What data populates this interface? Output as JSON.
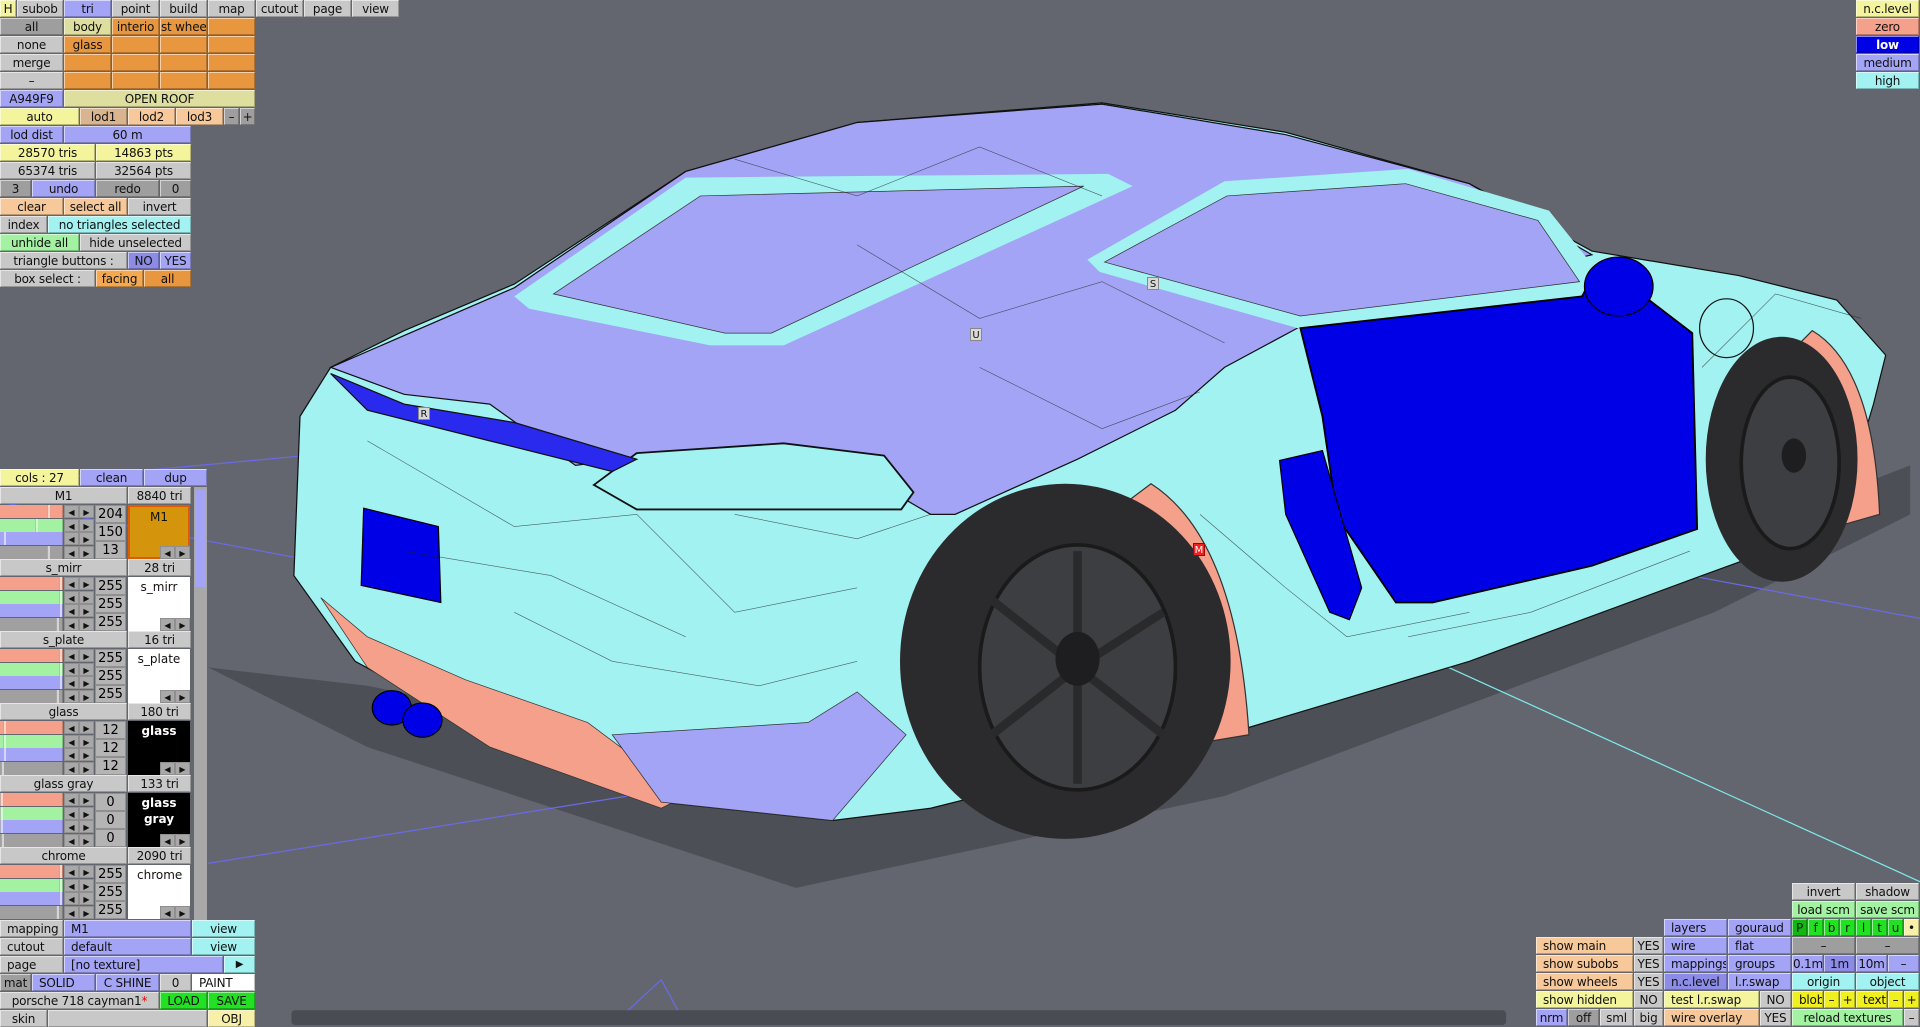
{
  "colors": {
    "body_high": "#a2f2f2",
    "roof_medium": "#a4a4f6",
    "door_low": "#0000e6",
    "zero": "#f5a08a",
    "tire": "#2b2b2d",
    "ground": "#63666f"
  },
  "top_tabs": [
    "H",
    "subob",
    "tri",
    "point",
    "build",
    "map",
    "cutout",
    "page",
    "view"
  ],
  "select": {
    "all": "all",
    "none": "none",
    "merge": "merge",
    "dash": "–"
  },
  "groups": [
    "body",
    "interio",
    "st whee",
    "glass"
  ],
  "color_code": "A949F9",
  "open_roof": "OPEN ROOF",
  "lod": {
    "auto": "auto",
    "lod1": "lod1",
    "lod2": "lod2",
    "lod3": "lod3",
    "minus": "–",
    "plus": "+",
    "dist_label": "lod dist",
    "dist_value": "60 m"
  },
  "stats": {
    "sel_tris": "28570 tris",
    "sel_pts": "14863 pts",
    "total_tris": "65374 tris",
    "total_pts": "32564 pts"
  },
  "history": {
    "undo_count": "3",
    "undo": "undo",
    "redo": "redo",
    "redo_count": "0"
  },
  "selection": {
    "clear": "clear",
    "select_all": "select all",
    "invert": "invert",
    "index": "index",
    "status": "no triangles selected",
    "unhide_all": "unhide all",
    "hide_unselected": "hide unselected",
    "triangle_buttons": "triangle buttons :",
    "no": "NO",
    "yes": "YES",
    "box_select": "box select :",
    "facing": "facing",
    "all": "all"
  },
  "nc_level": {
    "title": "n.c.level",
    "zero": "zero",
    "low": "low",
    "medium": "medium",
    "high": "high"
  },
  "viewport_labels": {
    "u": "U",
    "s": "S",
    "r": "R",
    "m": "M"
  },
  "materials_header": {
    "cols": "cols : 27",
    "clean": "clean",
    "dup": "dup"
  },
  "materials": [
    {
      "name": "M1",
      "tris": "8840 tri",
      "values": [
        204,
        150,
        13
      ],
      "shine": 0.8,
      "preview": "M1",
      "preview_bg": "#d4940c",
      "preview_fg": "#111",
      "selected": true
    },
    {
      "name": "s_mirr",
      "tris": "28 tri",
      "values": [
        255,
        255,
        255
      ],
      "shine": 0.95,
      "preview": "s_mirr",
      "preview_bg": "#ffffff",
      "preview_fg": "#111"
    },
    {
      "name": "s_plate",
      "tris": "16 tri",
      "values": [
        255,
        255,
        255
      ],
      "shine": 0.95,
      "preview": "s_plate",
      "preview_bg": "#ffffff",
      "preview_fg": "#111"
    },
    {
      "name": "glass",
      "tris": "180 tri",
      "values": [
        12,
        12,
        12
      ],
      "shine": 0.02,
      "preview": "glass",
      "preview_bg": "#000000",
      "preview_fg": "#ffffff"
    },
    {
      "name": "glass gray",
      "tris": "133 tri",
      "values": [
        0,
        0,
        0
      ],
      "shine": 0.02,
      "preview": "glass gray",
      "preview_bg": "#000000",
      "preview_fg": "#ffffff"
    },
    {
      "name": "chrome",
      "tris": "2090 tri",
      "values": [
        255,
        255,
        255
      ],
      "shine": 0.95,
      "preview": "chrome",
      "preview_bg": "#ffffff",
      "preview_fg": "#111"
    }
  ],
  "bottom_left": {
    "mapping": "mapping",
    "mapping_value": "M1",
    "view": "view",
    "cutout": "cutout",
    "cutout_value": "default",
    "page": "page",
    "page_value": "[no texture]",
    "play": "▶",
    "mat": "mat",
    "solid": "SOLID",
    "cshine": "C SHINE",
    "zero": "0",
    "paint": "PAINT",
    "file": "porsche 718 cayman1",
    "modified": "*",
    "load": "LOAD",
    "save": "SAVE",
    "skin": "skin",
    "obj": "OBJ"
  },
  "bottom_right": {
    "invert": "invert",
    "shadow": "shadow",
    "load_scm": "load scm",
    "save_scm": "save scm",
    "layers": "layers",
    "gouraud": "gouraud",
    "views": [
      "P",
      "f",
      "b",
      "r",
      "l",
      "t",
      "u",
      "•"
    ],
    "show_main": "show main",
    "show_main_v": "YES",
    "wire": "wire",
    "flat": "flat",
    "dash1": "–",
    "dash2": "–",
    "show_subobs": "show subobs",
    "show_subobs_v": "YES",
    "mappings": "mappings",
    "groups": "groups",
    "g01": "0.1m",
    "g1": "1m",
    "g10": "10m",
    "gminus": "–",
    "show_wheels": "show wheels",
    "show_wheels_v": "YES",
    "nclevel": "n.c.level",
    "lrswap": "l.r.swap",
    "origin": "origin",
    "object": "object",
    "show_hidden": "show hidden",
    "show_hidden_v": "NO",
    "test_lrswap": "test l.r.swap",
    "test_lrswap_v": "NO",
    "blob": "blob",
    "blob_minus": "–",
    "blob_plus": "+",
    "text": "text",
    "text_minus": "–",
    "text_plus": "+",
    "nrm": "nrm",
    "off": "off",
    "sml": "sml",
    "big": "big",
    "wire_overlay": "wire overlay",
    "wire_overlay_v": "YES",
    "reload": "reload textures",
    "reload_minus": "–"
  }
}
